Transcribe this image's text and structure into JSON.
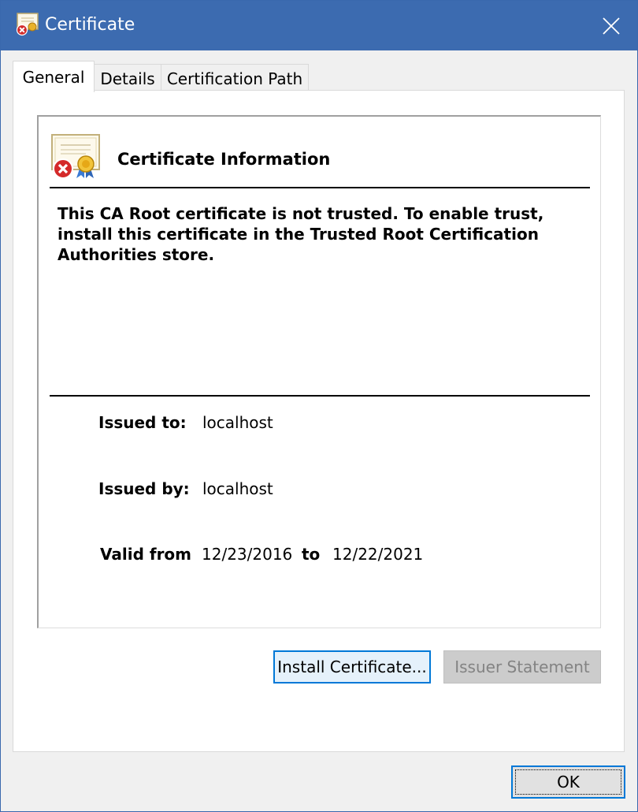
{
  "window": {
    "title": "Certificate",
    "icons": {
      "app": "certificate-error-icon",
      "close": "close-icon"
    },
    "colors": {
      "titlebar": "#3c6bb0",
      "accent": "#0078d7"
    }
  },
  "tabs": [
    {
      "label": "General",
      "active": true
    },
    {
      "label": "Details",
      "active": false
    },
    {
      "label": "Certification Path",
      "active": false
    }
  ],
  "general": {
    "header_title": "Certificate Information",
    "header_icon": "certificate-untrusted-icon",
    "warning": "This CA Root certificate is not trusted. To enable trust, install this certificate in the Trusted Root Certification Authorities store.",
    "issued_to_label": "Issued to:",
    "issued_to_value": "localhost",
    "issued_by_label": "Issued by:",
    "issued_by_value": "localhost",
    "valid_from_label": "Valid from",
    "valid_from_value": "12/23/2016",
    "valid_to_label": "to",
    "valid_to_value": "12/22/2021"
  },
  "buttons": {
    "install": "Install Certificate...",
    "issuer_statement": "Issuer Statement",
    "ok": "OK"
  }
}
